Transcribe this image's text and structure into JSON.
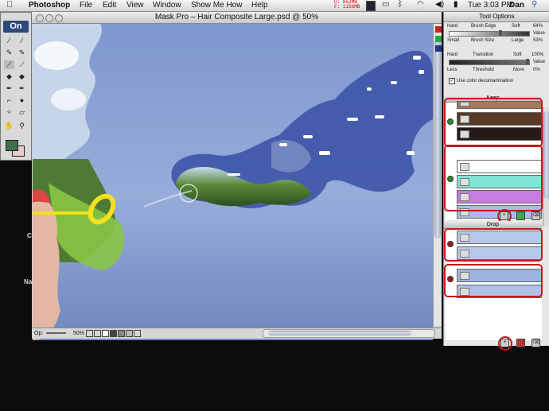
{
  "menubar": {
    "app_name": "Photoshop",
    "items": [
      "File",
      "Edit",
      "View",
      "Window",
      "Show Me How",
      "Help"
    ],
    "memory_u": "U: 852MB",
    "memory_f": "F: 1156MB",
    "clock": "Tue 3:03 PM",
    "user": "Dan"
  },
  "desktop": {
    "char_c": "C",
    "char_na": "Na"
  },
  "document": {
    "title": "Mask Pro – Hair Composite Large.psd @ 50%",
    "status_op": "Op:",
    "status_zoom": "50%"
  },
  "toolbox": {
    "logo": "On"
  },
  "tool_options": {
    "title": "Tool Options",
    "brush_edge": {
      "left": "Hard",
      "label": "Brush Edge",
      "right": "Soft",
      "value": "64%",
      "value_label": "Value"
    },
    "brush_size": {
      "left": "Small",
      "label": "Brush Size",
      "right": "Large",
      "value": "53%"
    },
    "transition": {
      "left": "Hard",
      "label": "Transition",
      "right": "Soft",
      "value": "100%",
      "value_label": "Value"
    },
    "threshold": {
      "left": "Less",
      "label": "Threshold",
      "right": "More",
      "value": "0%"
    },
    "decontam_label": "Use color decontamination",
    "decontam_checked": "✓"
  },
  "keep": {
    "label": "Keep",
    "group1_colors": [
      "#a27a58",
      "#5a3a26",
      "#241c18"
    ],
    "group2_colors": [
      "#ffffff",
      "#7fe5d5",
      "#c57de0",
      "#aabde8"
    ],
    "group1_dot": "#2a8a2a",
    "group2_dot": "#2a8a2a"
  },
  "drop": {
    "label": "Drop",
    "group1_colors": [
      "#b6c8ec",
      "#b6c8ec"
    ],
    "group2_colors": [
      "#9db3df",
      "#aec0e6"
    ],
    "group1_dot": "#a01a1a",
    "group2_dot": "#a01a1a"
  },
  "colors": {
    "sky": "#8aa3d6",
    "highlight_red": "#c21a1a"
  }
}
